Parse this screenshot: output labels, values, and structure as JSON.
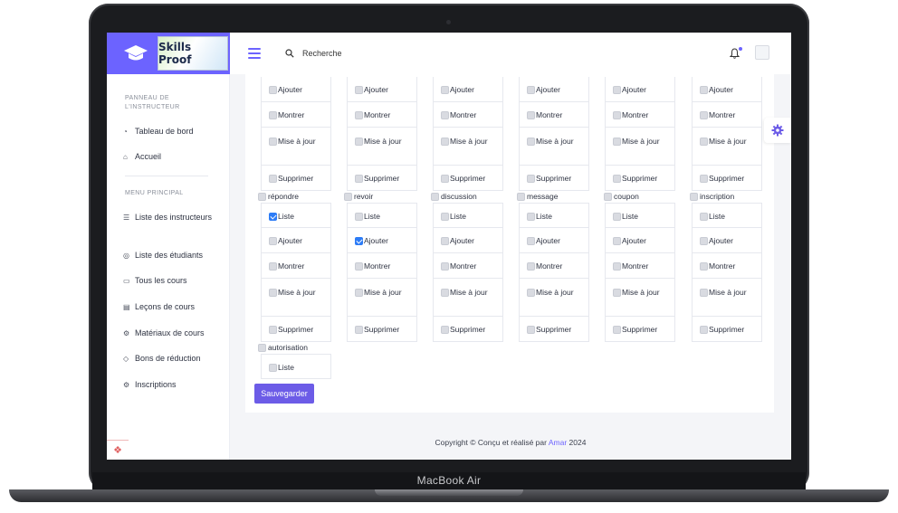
{
  "device": {
    "brand_label": "MacBook Air"
  },
  "logo": {
    "text": "Skills Proof"
  },
  "sidebar": {
    "section1": "PANNEAU DE L'INSTRUCTEUR",
    "section1_items": [
      {
        "label": "Tableau de bord",
        "icon": "gauge-icon"
      },
      {
        "label": "Accueil",
        "icon": "home-icon"
      }
    ],
    "section2": "MENU PRINCIPAL",
    "section2_items": [
      {
        "label": "Liste des instructeurs",
        "icon": "list-icon"
      },
      {
        "label": "Liste des étudiants",
        "icon": "users-icon"
      },
      {
        "label": "Tous les cours",
        "icon": "book-icon"
      },
      {
        "label": "Leçons de cours",
        "icon": "image-icon"
      },
      {
        "label": "Matériaux de cours",
        "icon": "gear-icon"
      },
      {
        "label": "Bons de réduction",
        "icon": "tag-icon"
      },
      {
        "label": "Inscriptions",
        "icon": "gear-icon"
      }
    ]
  },
  "topbar": {
    "search_placeholder": "Recherche"
  },
  "permissions": {
    "top_partial_rows": [
      [
        "Ajouter",
        "Ajouter",
        "Ajouter",
        "Ajouter",
        "Ajouter",
        "Ajouter"
      ],
      [
        "Montrer",
        "Montrer",
        "Montrer",
        "Montrer",
        "Montrer",
        "Montrer"
      ],
      [
        "Mise à jour",
        "Mise à jour",
        "Mise à jour",
        "Mise à jour",
        "Mise à jour",
        "Mise à jour"
      ],
      [
        "Supprimer",
        "Supprimer",
        "Supprimer",
        "Supprimer",
        "Supprimer",
        "Supprimer"
      ]
    ],
    "groups": [
      "répondre",
      "revoir",
      "discussion",
      "message",
      "coupon",
      "inscription"
    ],
    "actions": [
      "Liste",
      "Ajouter",
      "Montrer",
      "Mise à jour",
      "Supprimer"
    ],
    "checked": {
      "répondre": [
        "Liste"
      ],
      "revoir": [
        "Ajouter"
      ]
    },
    "extra_group": "autorisation",
    "extra_actions": [
      "Liste"
    ]
  },
  "save_button": "Sauvegarder",
  "footer": {
    "prefix": "Copyright © Conçu et réalisé par ",
    "author": "Amar",
    "year": " 2024"
  },
  "colors": {
    "accent": "#6c63ff",
    "checkbox_checked": "#2d7cf6"
  }
}
